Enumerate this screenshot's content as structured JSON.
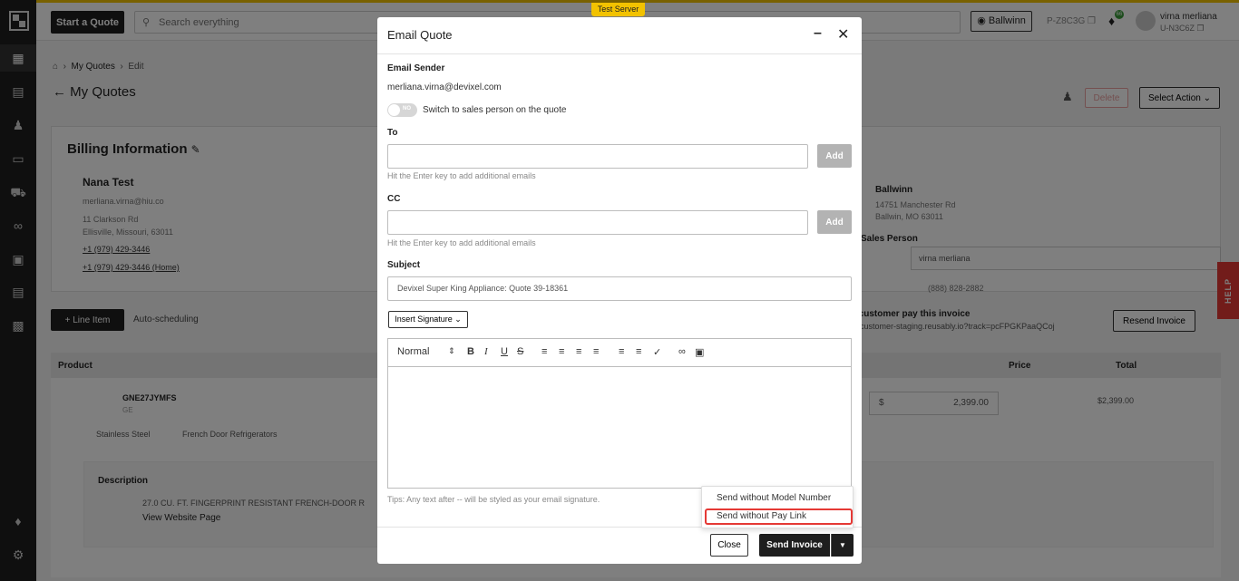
{
  "banner": {
    "test_server": "Test Server"
  },
  "header": {
    "start_quote": "Start a Quote",
    "search_placeholder": "Search everything",
    "location": "Ballwinn",
    "pcode": "P-Z8C3G",
    "notification_count": "66",
    "user_name": "virna merliana",
    "user_code": "U-N3C6Z"
  },
  "page": {
    "breadcrumb": {
      "level1": "My Quotes",
      "level2": "Edit"
    },
    "title": "My Quotes",
    "delete": "Delete",
    "select_action": "Select Action"
  },
  "billing": {
    "title": "Billing Information",
    "customer_name": "Nana Test",
    "email": "merliana.virna@hiu.co",
    "address1": "11 Clarkson Rd",
    "address2": "Ellisville, Missouri, 63011",
    "phone1": "+1 (979) 429-3446",
    "phone2": "+1 (979) 429-3446 (Home)",
    "store_name": "Ballwinn",
    "store_addr1": "14751 Manchester Rd",
    "store_addr2": "Ballwin, MO 63011",
    "sales_person_label": "Sales Person",
    "sales_person": "virna merliana",
    "sales_phone": "(888) 828-2882"
  },
  "actions": {
    "line_item": "Line Item",
    "auto_scheduling": "Auto-scheduling",
    "pay_invoice_label": "r customer pay this invoice",
    "pay_link": "customer-staging.reusably.io?track=pcFPGKPaaQCoj",
    "resend_invoice": "Resend Invoice"
  },
  "table": {
    "headers": {
      "product": "Product",
      "price": "Price",
      "total": "Total"
    },
    "row": {
      "sku": "GNE27JYMFS",
      "brand": "GE",
      "finish": "Stainless Steel",
      "category": "French Door Refrigerators",
      "price": "2,399.00",
      "currency": "$",
      "total": "$2,399.00",
      "desc_title": "Description",
      "desc_text": "27.0 CU. FT. FINGERPRINT RESISTANT FRENCH-DOOR R",
      "view_page": "View Website Page"
    }
  },
  "help": "HELP",
  "modal": {
    "title": "Email Quote",
    "sender_label": "Email Sender",
    "sender_email": "merliana.virna@devixel.com",
    "toggle_state": "NO",
    "toggle_label": "Switch to sales person on the quote",
    "to_label": "To",
    "to_value": "",
    "add": "Add",
    "hint": "Hit the Enter key to add additional emails",
    "cc_label": "CC",
    "cc_value": "",
    "subject_label": "Subject",
    "subject_value": "Devixel Super King Appliance: Quote 39-18361",
    "insert_signature": "Insert Signature",
    "editor_format": "Normal",
    "tips": "Tips: Any text after -- will be styled as your email signature.",
    "close": "Close",
    "send_invoice": "Send Invoice",
    "dropdown": {
      "item1": "Send without Model Number",
      "item2": "Send without Pay Link"
    }
  }
}
